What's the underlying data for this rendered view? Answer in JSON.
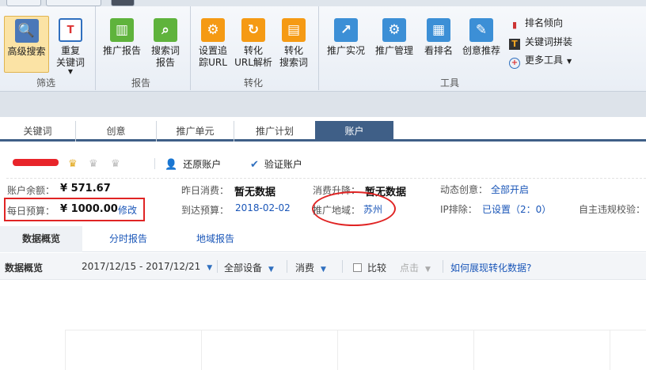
{
  "ribbon": {
    "groups": {
      "filter": "筛选",
      "report": "报告",
      "convert": "转化",
      "tools": "工具"
    },
    "buttons": {
      "advanced_search": "高级搜索",
      "repeat_kw_1": "重复",
      "repeat_kw_2": "关键词",
      "promo_report_1": "推广报告",
      "search_report_1": "搜索词",
      "search_report_2": "报告",
      "setup_track_1": "设置追",
      "setup_track_2": "踪URL",
      "convert_url_1": "转化",
      "convert_url_2": "URL解析",
      "convert_search_1": "转化",
      "convert_search_2": "搜索词",
      "promo_live": "推广实况",
      "promo_manage": "推广管理",
      "view_rank": "看排名",
      "creative_rec": "创意推荐"
    },
    "small_tools": {
      "rank_trend": "排名倾向",
      "kw_combine": "关键词拼装",
      "more_tools": "更多工具"
    }
  },
  "main_tabs": [
    "关键词",
    "创意",
    "推广单元",
    "推广计划",
    "账户"
  ],
  "account": {
    "restore": "还原账户",
    "verify": "验证账户"
  },
  "info": {
    "balance_label": "账户余额：",
    "balance_value": "¥ 571.67",
    "daily_budget_label": "每日预算：",
    "daily_budget_value": "¥ 1000.00",
    "modify": "修改",
    "yesterday_label": "昨日消费：",
    "yesterday_value": "暂无数据",
    "reach_budget_label": "到达预算：",
    "reach_budget_value": "2018-02-02",
    "spend_change_label": "消费升降：",
    "spend_change_value": "暂无数据",
    "region_label": "推广地域：",
    "region_value": "苏州",
    "dynamic_creative_label": "动态创意：",
    "dynamic_creative_value": "全部开启",
    "ip_exclude_label": "IP排除：",
    "ip_exclude_value": "已设置（2：0）",
    "self_check_label": "自主违规校验："
  },
  "sub_tabs": [
    "数据概览",
    "分时报告",
    "地域报告"
  ],
  "filter": {
    "title": "数据概览",
    "date_range": "2017/12/15 - 2017/12/21",
    "device": "全部设备",
    "metric": "消费",
    "compare": "比较",
    "click": "点击",
    "help_link": "如何展现转化数据?"
  },
  "colors": {
    "accent": "#3f5f87",
    "link": "#1a56b8",
    "annotation": "#e02424"
  }
}
